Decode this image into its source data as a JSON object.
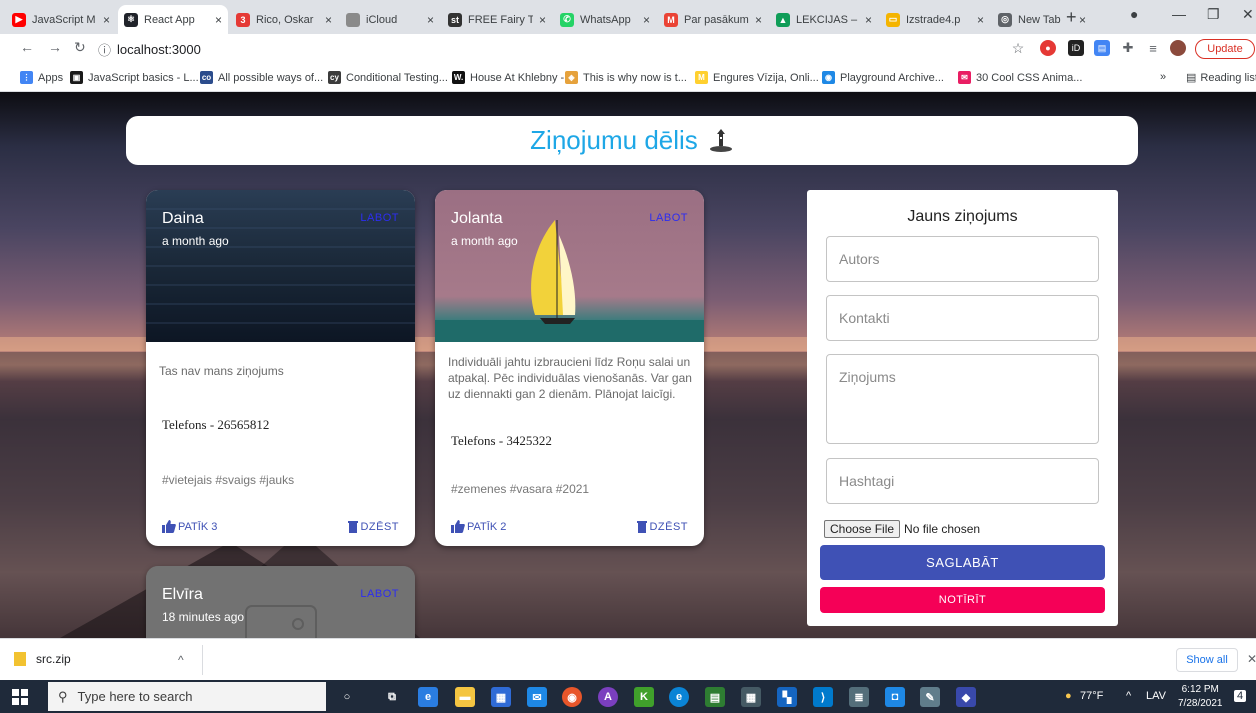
{
  "browser": {
    "tabs": [
      {
        "label": "JavaScript M",
        "icon": "youtube-icon",
        "color": "#ff0000",
        "glyph": "▶"
      },
      {
        "label": "React App",
        "icon": "react-icon",
        "color": "#20232a",
        "glyph": "⚛"
      },
      {
        "label": "Rico, Oskar",
        "icon": "b-icon",
        "color": "#e53935",
        "glyph": "3"
      },
      {
        "label": "iCloud",
        "icon": "apple-icon",
        "color": "#8a8a8a",
        "glyph": ""
      },
      {
        "label": "FREE Fairy T",
        "icon": "st-icon",
        "color": "#333333",
        "glyph": "st"
      },
      {
        "label": "WhatsApp",
        "icon": "whatsapp-icon",
        "color": "#25d366",
        "glyph": "✆"
      },
      {
        "label": "Par pasākum",
        "icon": "gmail-icon",
        "color": "#ea4335",
        "glyph": "M"
      },
      {
        "label": "LEKCIJAS – ",
        "icon": "drive-icon",
        "color": "#0f9d58",
        "glyph": "▲"
      },
      {
        "label": "Izstrade4.p",
        "icon": "slides-icon",
        "color": "#f4b400",
        "glyph": "▭"
      },
      {
        "label": "New Tab",
        "icon": "chrome-icon",
        "color": "#5f6368",
        "glyph": "◎"
      }
    ],
    "url": "localhost:3000",
    "update_label": "Update",
    "bookmarks": [
      {
        "label": "Apps",
        "icon": "apps-icon",
        "color": "#4285f4",
        "glyph": "⋮"
      },
      {
        "label": "JavaScript basics - L...",
        "icon": "mdn-icon",
        "color": "#1a1a1a",
        "glyph": "▣"
      },
      {
        "label": "All possible ways of...",
        "icon": "cc-icon",
        "color": "#2b4c8c",
        "glyph": "co"
      },
      {
        "label": "Conditional Testing...",
        "icon": "cy-icon",
        "color": "#3c3c3c",
        "glyph": "cy"
      },
      {
        "label": "House At Khlebny -...",
        "icon": "w-icon",
        "color": "#111111",
        "glyph": "W."
      },
      {
        "label": "This is why now is t...",
        "icon": "medium-icon",
        "color": "#e6a23c",
        "glyph": "◈"
      },
      {
        "label": "Engures Vīzija, Onli...",
        "icon": "miro-icon",
        "color": "#ffd02f",
        "glyph": "M"
      },
      {
        "label": "Playground Archive...",
        "icon": "playground-icon",
        "color": "#1e88e5",
        "glyph": "◉"
      },
      {
        "label": "30 Cool CSS Anima...",
        "icon": "mail-icon",
        "color": "#e91e63",
        "glyph": "✉"
      }
    ],
    "overflow_label": "»",
    "reading_list_label": "Reading list"
  },
  "header": {
    "title": "Ziņojumu dēlis"
  },
  "cards": [
    {
      "author": "Daina",
      "time": "a month ago",
      "edit_label": "LABOT",
      "message": "Tas nav mans ziņojums",
      "phone": "Telefons - 26565812",
      "tags": "#vietejais #svaigs #jauks",
      "like_label": "PATĪK 3",
      "delete_label": "DZĒST"
    },
    {
      "author": "Jolanta",
      "time": "a month ago",
      "edit_label": "LABOT",
      "message": "Individuāli jahtu izbraucieni līdz Roņu salai un atpakaļ. Pēc individuālas vienošanās. Var gan uz diennakti gan 2 dienām. Plānojat laicīgi.",
      "phone": "Telefons - 3425322",
      "tags": "#zemenes #vasara #2021",
      "like_label": "PATĪK 2",
      "delete_label": "DZĒST"
    },
    {
      "author": "Elvīra",
      "time": "18 minutes ago",
      "edit_label": "LABOT"
    }
  ],
  "form": {
    "title": "Jauns ziņojums",
    "author_placeholder": "Autors",
    "contacts_placeholder": "Kontakti",
    "message_placeholder": "Ziņojums",
    "hashtags_placeholder": "Hashtagi",
    "file_button": "Choose File",
    "file_status": "No file chosen",
    "save_label": "SAGLABĀT",
    "clear_label": "NOTĪRĪT"
  },
  "downloads": {
    "file": "src.zip",
    "show_all": "Show all"
  },
  "taskbar": {
    "search_placeholder": "Type here to search",
    "weather": "77°F",
    "lang": "LAV",
    "time": "6:12 PM",
    "date": "7/28/2021",
    "notifications": "4"
  },
  "colors": {
    "accent": "#3f51b5",
    "danger": "#f50057",
    "title": "#1ea7e6",
    "edit": "#2d2df0"
  }
}
